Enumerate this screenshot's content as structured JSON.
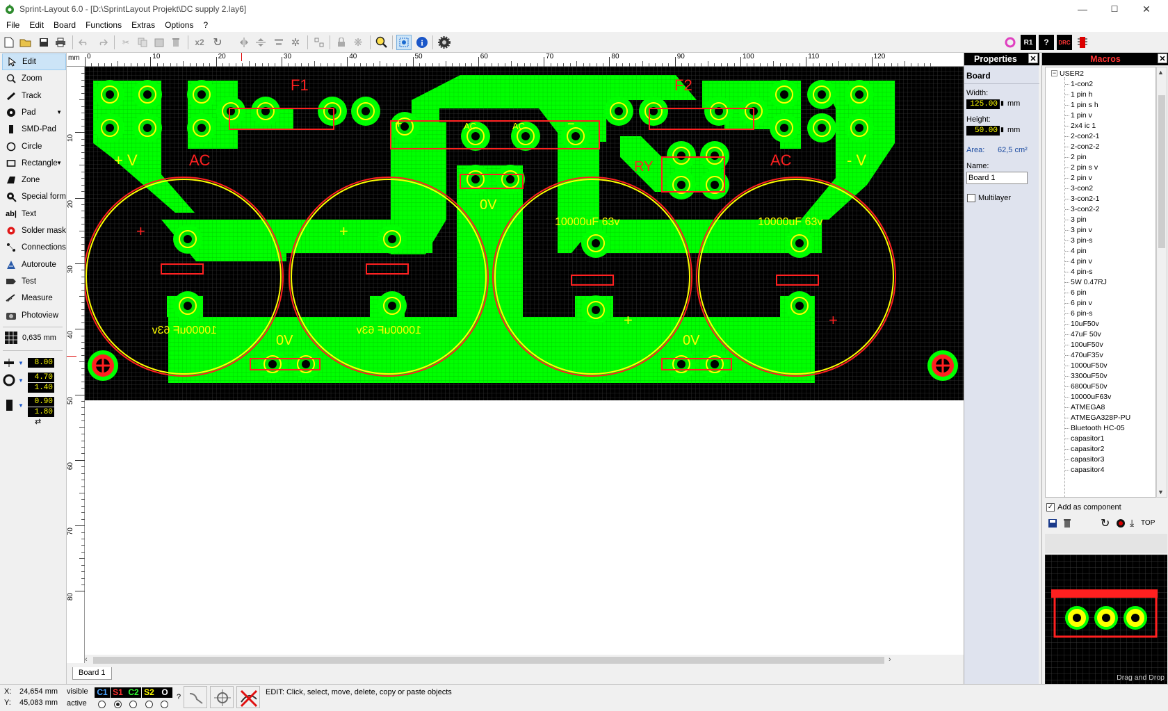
{
  "window": {
    "title": "Sprint-Layout 6.0 - [D:\\SprintLayout Projekt\\DC supply 2.lay6]",
    "minimize_glyph": "—",
    "maximize_glyph": "☐",
    "close_glyph": "✕"
  },
  "menu": [
    "File",
    "Edit",
    "Board",
    "Functions",
    "Extras",
    "Options",
    "?"
  ],
  "toolbar": {
    "icons": [
      "new-icon",
      "open-icon",
      "save-icon",
      "print-icon",
      "undo-icon",
      "redo-icon",
      "cut-icon",
      "copy-icon",
      "paste-icon",
      "delete-icon",
      "duplicate-x2-icon",
      "rotate-icon",
      "mirror-h-icon",
      "mirror-v-icon",
      "align-icon",
      "group-icon",
      "ungroup-icon",
      "lock-icon",
      "unlock-icon",
      "zoom-search-icon",
      "snap-grid-icon",
      "info-icon",
      "settings-gear-icon"
    ],
    "x2_label": "x2",
    "right_icons": [
      "rubberband-icon",
      "r1-icon",
      "help-icon",
      "drc-icon",
      "ic-icon"
    ]
  },
  "toolbox": {
    "tools": [
      {
        "label": "Edit",
        "icon": "cursor-arrow-icon",
        "selected": true
      },
      {
        "label": "Zoom",
        "icon": "magnifier-icon"
      },
      {
        "label": "Track",
        "icon": "track-line-icon"
      },
      {
        "label": "Pad",
        "icon": "pad-icon",
        "dropdown": true
      },
      {
        "label": "SMD-Pad",
        "icon": "smd-pad-icon"
      },
      {
        "label": "Circle",
        "icon": "circle-icon"
      },
      {
        "label": "Rectangle",
        "icon": "rectangle-icon",
        "dropdown": true
      },
      {
        "label": "Zone",
        "icon": "zone-icon"
      },
      {
        "label": "Special form",
        "icon": "special-form-icon"
      },
      {
        "label": "Text",
        "icon": "text-icon"
      },
      {
        "label": "Solder mask",
        "icon": "solder-mask-icon"
      },
      {
        "label": "Connections",
        "icon": "connections-icon"
      },
      {
        "label": "Autoroute",
        "icon": "autoroute-icon"
      },
      {
        "label": "Test",
        "icon": "test-icon"
      },
      {
        "label": "Measure",
        "icon": "measure-icon"
      },
      {
        "label": "Photoview",
        "icon": "photoview-icon"
      }
    ],
    "grid_value": "0,635 mm",
    "track_width": "8.00",
    "pad_outer": "4.70",
    "pad_inner": "1.40",
    "smd_w": "0.90",
    "smd_h": "1.80"
  },
  "ruler": {
    "unit": "mm",
    "top_ticks": [
      "0",
      "10",
      "20",
      "30",
      "40",
      "50",
      "60",
      "70",
      "80",
      "90",
      "100",
      "110",
      "120"
    ],
    "left_ticks": [
      "10",
      "20",
      "30",
      "40",
      "50",
      "60",
      "70",
      "80"
    ]
  },
  "pcb": {
    "labels": {
      "f1": "F1",
      "f2": "F2",
      "plus_v": "+ V",
      "minus_v": "- V",
      "ac_left": "AC",
      "ac_right": "AC",
      "ac_mid1": "AC",
      "ac_mid2": "AC",
      "ry": "RY",
      "zero_v_mid": "0V",
      "zero_v_left": "0V",
      "zero_v_right": "0V",
      "cap_value": "10000uF 63v",
      "cap_value_mirrored": "10000uF 63v",
      "plus": "+",
      "minus": "−"
    },
    "colors": {
      "background": "#000000",
      "copper": "#00ff00",
      "silk": "#ff2020",
      "outline": "#ffff00"
    }
  },
  "board_tab": "Board 1",
  "properties": {
    "header": "Properties",
    "section": "Board",
    "width_label": "Width:",
    "width_value": "125.00",
    "height_label": "Height:",
    "height_value": "50.00",
    "unit": "mm",
    "area_label": "Area:",
    "area_value": "62,5 cm²",
    "name_label": "Name:",
    "name_value": "Board 1",
    "multilayer_label": "Multilayer",
    "multilayer_checked": false
  },
  "macros": {
    "header": "Macros",
    "root": "USER2",
    "items": [
      "1-con2",
      "1 pin h",
      "1 pin s h",
      "1 pin v",
      "2x4 ic 1",
      "2-con2-1",
      "2-con2-2",
      "2 pin",
      "2 pin s v",
      "2 pin v",
      "3-con2",
      "3-con2-1",
      "3-con2-2",
      "3 pin",
      "3 pin v",
      "3 pin-s",
      "4 pin",
      "4 pin v",
      "4 pin-s",
      "5W 0.47RJ",
      "6 pin",
      "6 pin v",
      "6 pin-s",
      "10uF50v",
      "47uF 50v",
      "100uF50v",
      "470uF35v",
      "1000uF50v",
      "3300uF50v",
      "6800uF50v",
      "10000uF63v",
      "ATMEGA8",
      "ATMEGA328P-PU",
      "Bluetooth HC-05",
      "capasitor1",
      "capasitor2",
      "capasitor3",
      "capasitor4"
    ],
    "add_as_component": "Add as component",
    "add_checked": true,
    "top_label": "TOP",
    "drag_drop": "Drag and Drop"
  },
  "status": {
    "x_label": "X:",
    "x_value": "24,654 mm",
    "y_label": "Y:",
    "y_value": "45,083 mm",
    "visible": "visible",
    "active": "active",
    "layers": [
      {
        "label": "C1",
        "color": "#4aa3ff"
      },
      {
        "label": "S1",
        "color": "#ff3030"
      },
      {
        "label": "C2",
        "color": "#30ff30"
      },
      {
        "label": "S2",
        "color": "#ffff00"
      },
      {
        "label": "O",
        "color": "#ffffff"
      }
    ],
    "question": "?",
    "message": "EDIT:  Click, select, move, delete, copy or paste objects"
  }
}
